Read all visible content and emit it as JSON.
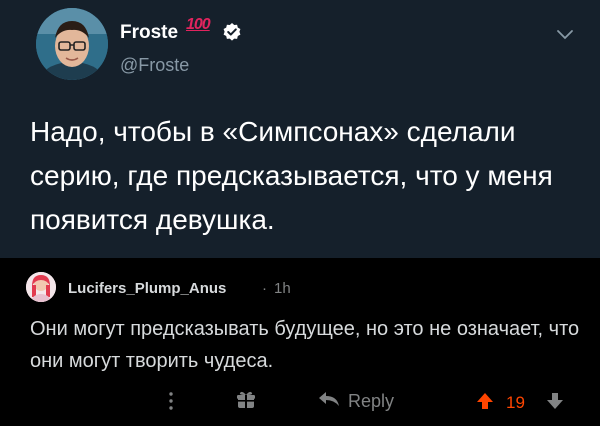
{
  "tweet": {
    "author_name": "Froste",
    "badge_emoji": "100",
    "handle": "@Froste",
    "text": "Надо, чтобы в «Симпсонах» сделали серию, где предсказывается, что у меня появится девушка.",
    "colors": {
      "background": "#15202b",
      "text": "#ffffff",
      "secondary": "#8899a6",
      "verified": "#1da1f2"
    },
    "icons": [
      "verified-icon",
      "chevron-down-icon"
    ]
  },
  "comment": {
    "username": "Lucifers_Plump_Anus",
    "separator": "·",
    "time": "1h",
    "text": "Они могут предсказывать будущее, но это не означает, что они могут творить чудеса.",
    "actions": {
      "reply_label": "Reply",
      "score": "19"
    },
    "colors": {
      "background": "#000000",
      "text": "#d7dadc",
      "muted": "#818384",
      "upvote": "#ff4500"
    },
    "icons": [
      "more-options-icon",
      "gift-icon",
      "reply-arrow-icon",
      "upvote-icon",
      "downvote-icon"
    ]
  }
}
